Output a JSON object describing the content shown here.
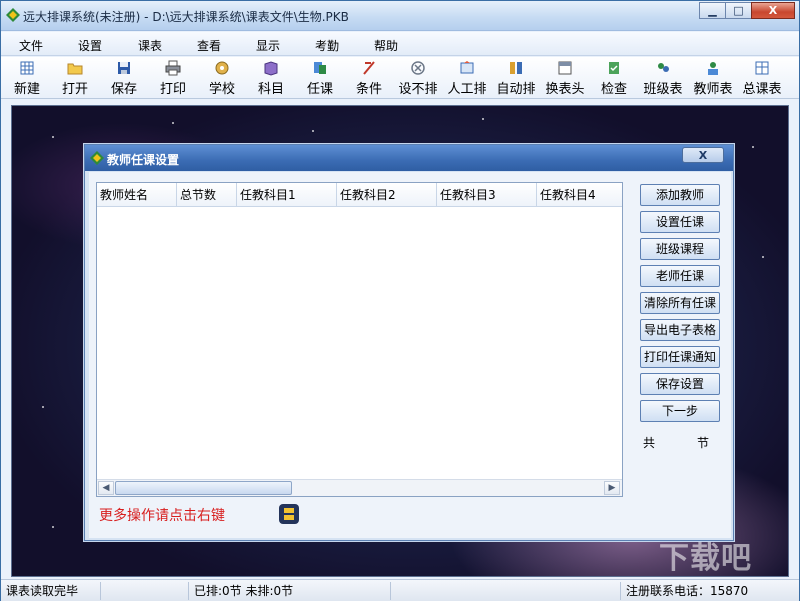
{
  "window": {
    "title": "远大排课系统(未注册) - D:\\远大排课系统\\课表文件\\生物.PKB",
    "minimize": "▁",
    "maximize": "□",
    "close": "X"
  },
  "menu": [
    "文件",
    "设置",
    "课表",
    "查看",
    "显示",
    "考勤",
    "帮助"
  ],
  "toolbar": [
    {
      "label": "新建",
      "icon": "new-icon"
    },
    {
      "label": "打开",
      "icon": "open-folder-icon"
    },
    {
      "label": "保存",
      "icon": "save-disk-icon"
    },
    {
      "label": "打印",
      "icon": "printer-icon"
    },
    {
      "label": "学校",
      "icon": "school-icon"
    },
    {
      "label": "科目",
      "icon": "book-icon"
    },
    {
      "label": "任课",
      "icon": "assign-icon"
    },
    {
      "label": "条件",
      "icon": "condition-icon"
    },
    {
      "label": "设不排",
      "icon": "forbid-icon"
    },
    {
      "label": "人工排",
      "icon": "manual-icon"
    },
    {
      "label": "自动排",
      "icon": "auto-icon"
    },
    {
      "label": "换表头",
      "icon": "header-icon"
    },
    {
      "label": "检查",
      "icon": "check-icon"
    },
    {
      "label": "班级表",
      "icon": "class-table-icon"
    },
    {
      "label": "教师表",
      "icon": "teacher-table-icon"
    },
    {
      "label": "总课表",
      "icon": "total-table-icon"
    }
  ],
  "dialog": {
    "title": "教师任课设置",
    "close": "X",
    "columns": [
      "教师姓名",
      "总节数",
      "任教科目1",
      "任教科目2",
      "任教科目3",
      "任教科目4"
    ],
    "hint": "更多操作请点击右键",
    "buttons": [
      "添加教师",
      "设置任课",
      "班级课程",
      "老师任课",
      "清除所有任课",
      "导出电子表格",
      "打印任课通知",
      "保存设置",
      "下一步"
    ],
    "total_prefix": "共",
    "total_suffix": "节"
  },
  "statusbar": {
    "message": "课表读取完毕",
    "schedule": "已排:0节 未排:0节",
    "contact": "注册联系电话：15870"
  },
  "watermark": "下载吧",
  "colors": {
    "hint_red": "#d81e1e",
    "dialog_title": "#3b6cb4"
  }
}
